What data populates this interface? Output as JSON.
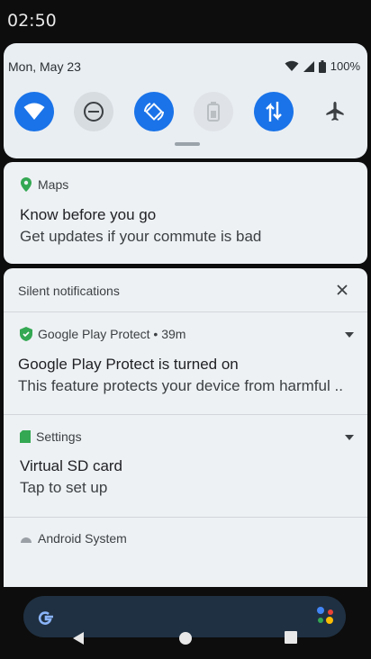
{
  "status_bar": {
    "time": "02:50"
  },
  "quick_settings": {
    "date": "Mon, May 23",
    "battery": "100%",
    "tiles": [
      {
        "name": "wifi",
        "state": "on"
      },
      {
        "name": "do-not-disturb",
        "state": "off"
      },
      {
        "name": "auto-rotate",
        "state": "on"
      },
      {
        "name": "battery-saver",
        "state": "disabled"
      },
      {
        "name": "mobile-data",
        "state": "on"
      },
      {
        "name": "airplane-mode",
        "state": "off"
      }
    ]
  },
  "maps_notification": {
    "app": "Maps",
    "title": "Know before you go",
    "body": "Get updates if your commute is bad"
  },
  "silent_section": {
    "header": "Silent notifications",
    "items": [
      {
        "app": "Google Play Protect • 39m",
        "title": "Google Play Protect is turned on",
        "body": "This feature protects your device from harmful .."
      },
      {
        "app": "Settings",
        "title": "Virtual SD card",
        "body": "Tap to set up"
      },
      {
        "app": "Android System",
        "title": "",
        "body": ""
      }
    ]
  },
  "colors": {
    "accent": "#1a73e8",
    "panel": "#e9eef3",
    "card": "#eef1f4"
  }
}
